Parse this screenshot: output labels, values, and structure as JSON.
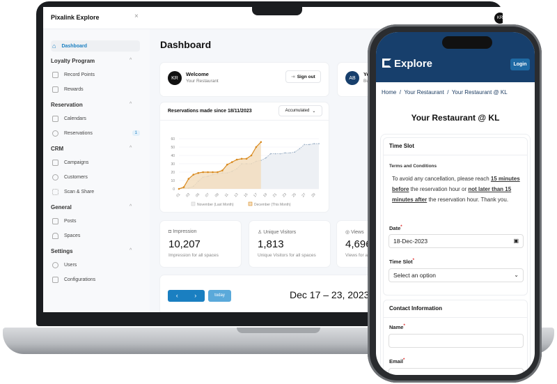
{
  "laptop": {
    "app_title": "Pixalink Explore",
    "user_initials": "KR",
    "sidebar": {
      "dashboard": "Dashboard",
      "sections": [
        {
          "title": "Loyalty Program",
          "items": [
            "Record Points",
            "Rewards"
          ]
        },
        {
          "title": "Reservation",
          "items": [
            "Calendars",
            "Reservations"
          ]
        },
        {
          "title": "CRM",
          "items": [
            "Campaigns",
            "Customers",
            "Scan & Share"
          ]
        },
        {
          "title": "General",
          "items": [
            "Posts",
            "Spaces"
          ]
        },
        {
          "title": "Settings",
          "items": [
            "Users",
            "Configurations"
          ]
        }
      ],
      "reservations_badge": "1"
    },
    "page_title": "Dashboard",
    "welcome": {
      "initials": "KR",
      "title": "Welcome",
      "subtitle": "Your Restaurant",
      "signout": "Sign out"
    },
    "business": {
      "initials": "AB",
      "title": "Yo",
      "subtitle": "Bu"
    },
    "chart_card": {
      "dropdown": "Accumulated"
    },
    "stats": [
      {
        "label": "Impression",
        "value": "10,207",
        "sub": "Impression for all spaces"
      },
      {
        "label": "Unique Visitors",
        "value": "1,813",
        "sub": "Unique Visitors for all spaces"
      },
      {
        "label": "Views",
        "value": "4,696",
        "sub": "Views for a"
      }
    ],
    "calendar": {
      "prev": "‹",
      "next": "›",
      "today": "today",
      "range": "Dec 17 – 23, 2023"
    }
  },
  "chart_data": {
    "type": "line",
    "title": "Reservations made since 18/11/2023",
    "ylim": [
      0,
      60
    ],
    "yticks": [
      0,
      10,
      20,
      30,
      40,
      50,
      60
    ],
    "xticks": [
      "01",
      "03",
      "05",
      "07",
      "09",
      "11",
      "13",
      "15",
      "17",
      "19",
      "21",
      "23",
      "25",
      "27",
      "29"
    ],
    "x": [
      1,
      2,
      3,
      4,
      5,
      6,
      7,
      8,
      9,
      10,
      11,
      12,
      13,
      14,
      15,
      16,
      17,
      18,
      19,
      20,
      21,
      22,
      23,
      24,
      25,
      26,
      27,
      28,
      29,
      30
    ],
    "series": [
      {
        "name": "November (Last Month)",
        "color": "#9fb3c8",
        "values": [
          0,
          1,
          1,
          3,
          9,
          14,
          15,
          17,
          18,
          19,
          19,
          21,
          24,
          30,
          30,
          30,
          33,
          34,
          37,
          42,
          42,
          42,
          43,
          43,
          44,
          48,
          53,
          53,
          54,
          54
        ]
      },
      {
        "name": "December (This Month)",
        "color": "#d98a1f",
        "values": [
          0,
          2,
          12,
          17,
          19,
          20,
          20,
          20,
          20,
          22,
          29,
          32,
          35,
          36,
          36,
          40,
          50,
          56
        ]
      }
    ],
    "grid": true,
    "legend": "bottom"
  },
  "phone": {
    "brand": "Explore",
    "login": "Login",
    "breadcrumb": [
      "Home",
      "Your Restaurant",
      "Your Restaurant @ KL"
    ],
    "title": "Your Restaurant @ KL",
    "time_slot": {
      "heading": "Time Slot",
      "terms_title": "Terms and Conditions",
      "t1": "To avoid any cancellation, please reach ",
      "b1": "15 minutes before",
      "t2": " the reservation hour or ",
      "b2": "not later than 15 minutes after",
      "t3": " the reservation hour. Thank you.",
      "date_label": "Date",
      "date_value": "18-Dec-2023",
      "slot_label": "Time Slot",
      "slot_placeholder": "Select an option"
    },
    "contact": {
      "heading": "Contact Information",
      "name_label": "Name",
      "email_label": "Email"
    }
  }
}
